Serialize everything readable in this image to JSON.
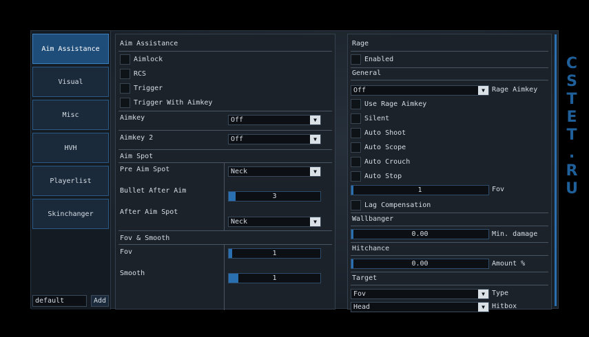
{
  "sidebar": {
    "tabs": [
      {
        "label": "Aim Assistance",
        "active": true
      },
      {
        "label": "Visual"
      },
      {
        "label": "Misc"
      },
      {
        "label": "HVH"
      },
      {
        "label": "Playerlist"
      },
      {
        "label": "Skinchanger"
      }
    ],
    "config_value": "default",
    "add_label": "Add"
  },
  "left": {
    "aim_assistance": {
      "title": "Aim Assistance",
      "checkboxes": [
        "Aimlock",
        "RCS",
        "Trigger",
        "Trigger With Aimkey"
      ]
    },
    "aimkey": {
      "label": "Aimkey",
      "value": "Off"
    },
    "aimkey2": {
      "label": "Aimkey 2",
      "value": "Off"
    },
    "aim_spot": {
      "title": "Aim Spot",
      "pre_label": "Pre Aim Spot",
      "pre_value": "Neck",
      "bullet_label": "Bullet After Aim",
      "bullet_value": "3",
      "after_label": "After Aim Spot",
      "after_value": "Neck"
    },
    "fov_smooth": {
      "title": "Fov & Smooth",
      "fov_label": "Fov",
      "fov_value": "1",
      "smooth_label": "Smooth",
      "smooth_value": "1"
    }
  },
  "right": {
    "rage": {
      "title": "Rage",
      "enabled_label": "Enabled"
    },
    "general": {
      "title": "General",
      "aimkey_value": "Off",
      "aimkey_label": "Rage Aimkey",
      "checkboxes": [
        "Use Rage Aimkey",
        "Silent",
        "Auto Shoot",
        "Auto Scope",
        "Auto Crouch",
        "Auto Stop"
      ],
      "fov_value": "1",
      "fov_label": "Fov",
      "lag_label": "Lag Compensation"
    },
    "wallbanger": {
      "title": "Wallbanger",
      "value": "0.00",
      "label": "Min. damage"
    },
    "hitchance": {
      "title": "Hitchance",
      "value": "0.00",
      "label": "Amount %"
    },
    "target": {
      "title": "Target",
      "type_value": "Fov",
      "type_label": "Type",
      "hitbox_value": "Head",
      "hitbox_label": "Hitbox"
    }
  },
  "watermark": [
    "C",
    "S",
    "T",
    "E",
    "T",
    ".",
    "R",
    "U"
  ],
  "colors": {
    "accent": "#2a6fb0",
    "active_tab": "#1f4d7a",
    "watermark": "#1f5f9a"
  }
}
